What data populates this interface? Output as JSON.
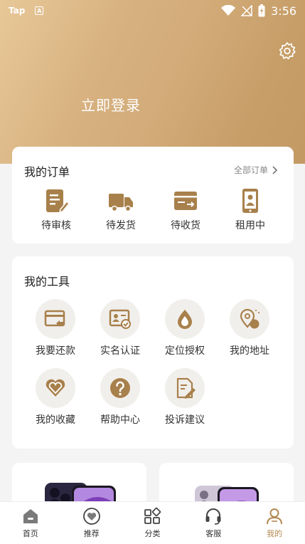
{
  "status_bar": {
    "app": "Tap",
    "a_badge": "A",
    "time": "3:56"
  },
  "header": {
    "login_label": "立即登录",
    "settings_icon": "gear-icon"
  },
  "orders": {
    "title": "我的订单",
    "all_label": "全部订单",
    "items": [
      {
        "label": "待审核",
        "icon": "edit-doc-icon"
      },
      {
        "label": "待发货",
        "icon": "truck-icon"
      },
      {
        "label": "待收货",
        "icon": "box-icon"
      },
      {
        "label": "租用中",
        "icon": "phone-user-icon"
      }
    ]
  },
  "tools": {
    "title": "我的工具",
    "items": [
      {
        "label": "我要还款",
        "icon": "repay-card-icon"
      },
      {
        "label": "实名认证",
        "icon": "id-card-icon"
      },
      {
        "label": "定位授权",
        "icon": "location-drop-icon"
      },
      {
        "label": "我的地址",
        "icon": "map-pin-icon"
      },
      {
        "label": "我的收藏",
        "icon": "heart-icon"
      },
      {
        "label": "帮助中心",
        "icon": "question-icon"
      },
      {
        "label": "投诉建议",
        "icon": "feedback-icon"
      }
    ]
  },
  "tabs": [
    {
      "label": "首页",
      "icon": "home-icon"
    },
    {
      "label": "推荐",
      "icon": "heart-circle-icon"
    },
    {
      "label": "分类",
      "icon": "category-icon"
    },
    {
      "label": "客服",
      "icon": "headset-icon"
    },
    {
      "label": "我的",
      "icon": "user-icon",
      "active": true
    }
  ],
  "colors": {
    "accent": "#b48a52",
    "header_start": "#e8c898",
    "header_end": "#c39a63"
  }
}
